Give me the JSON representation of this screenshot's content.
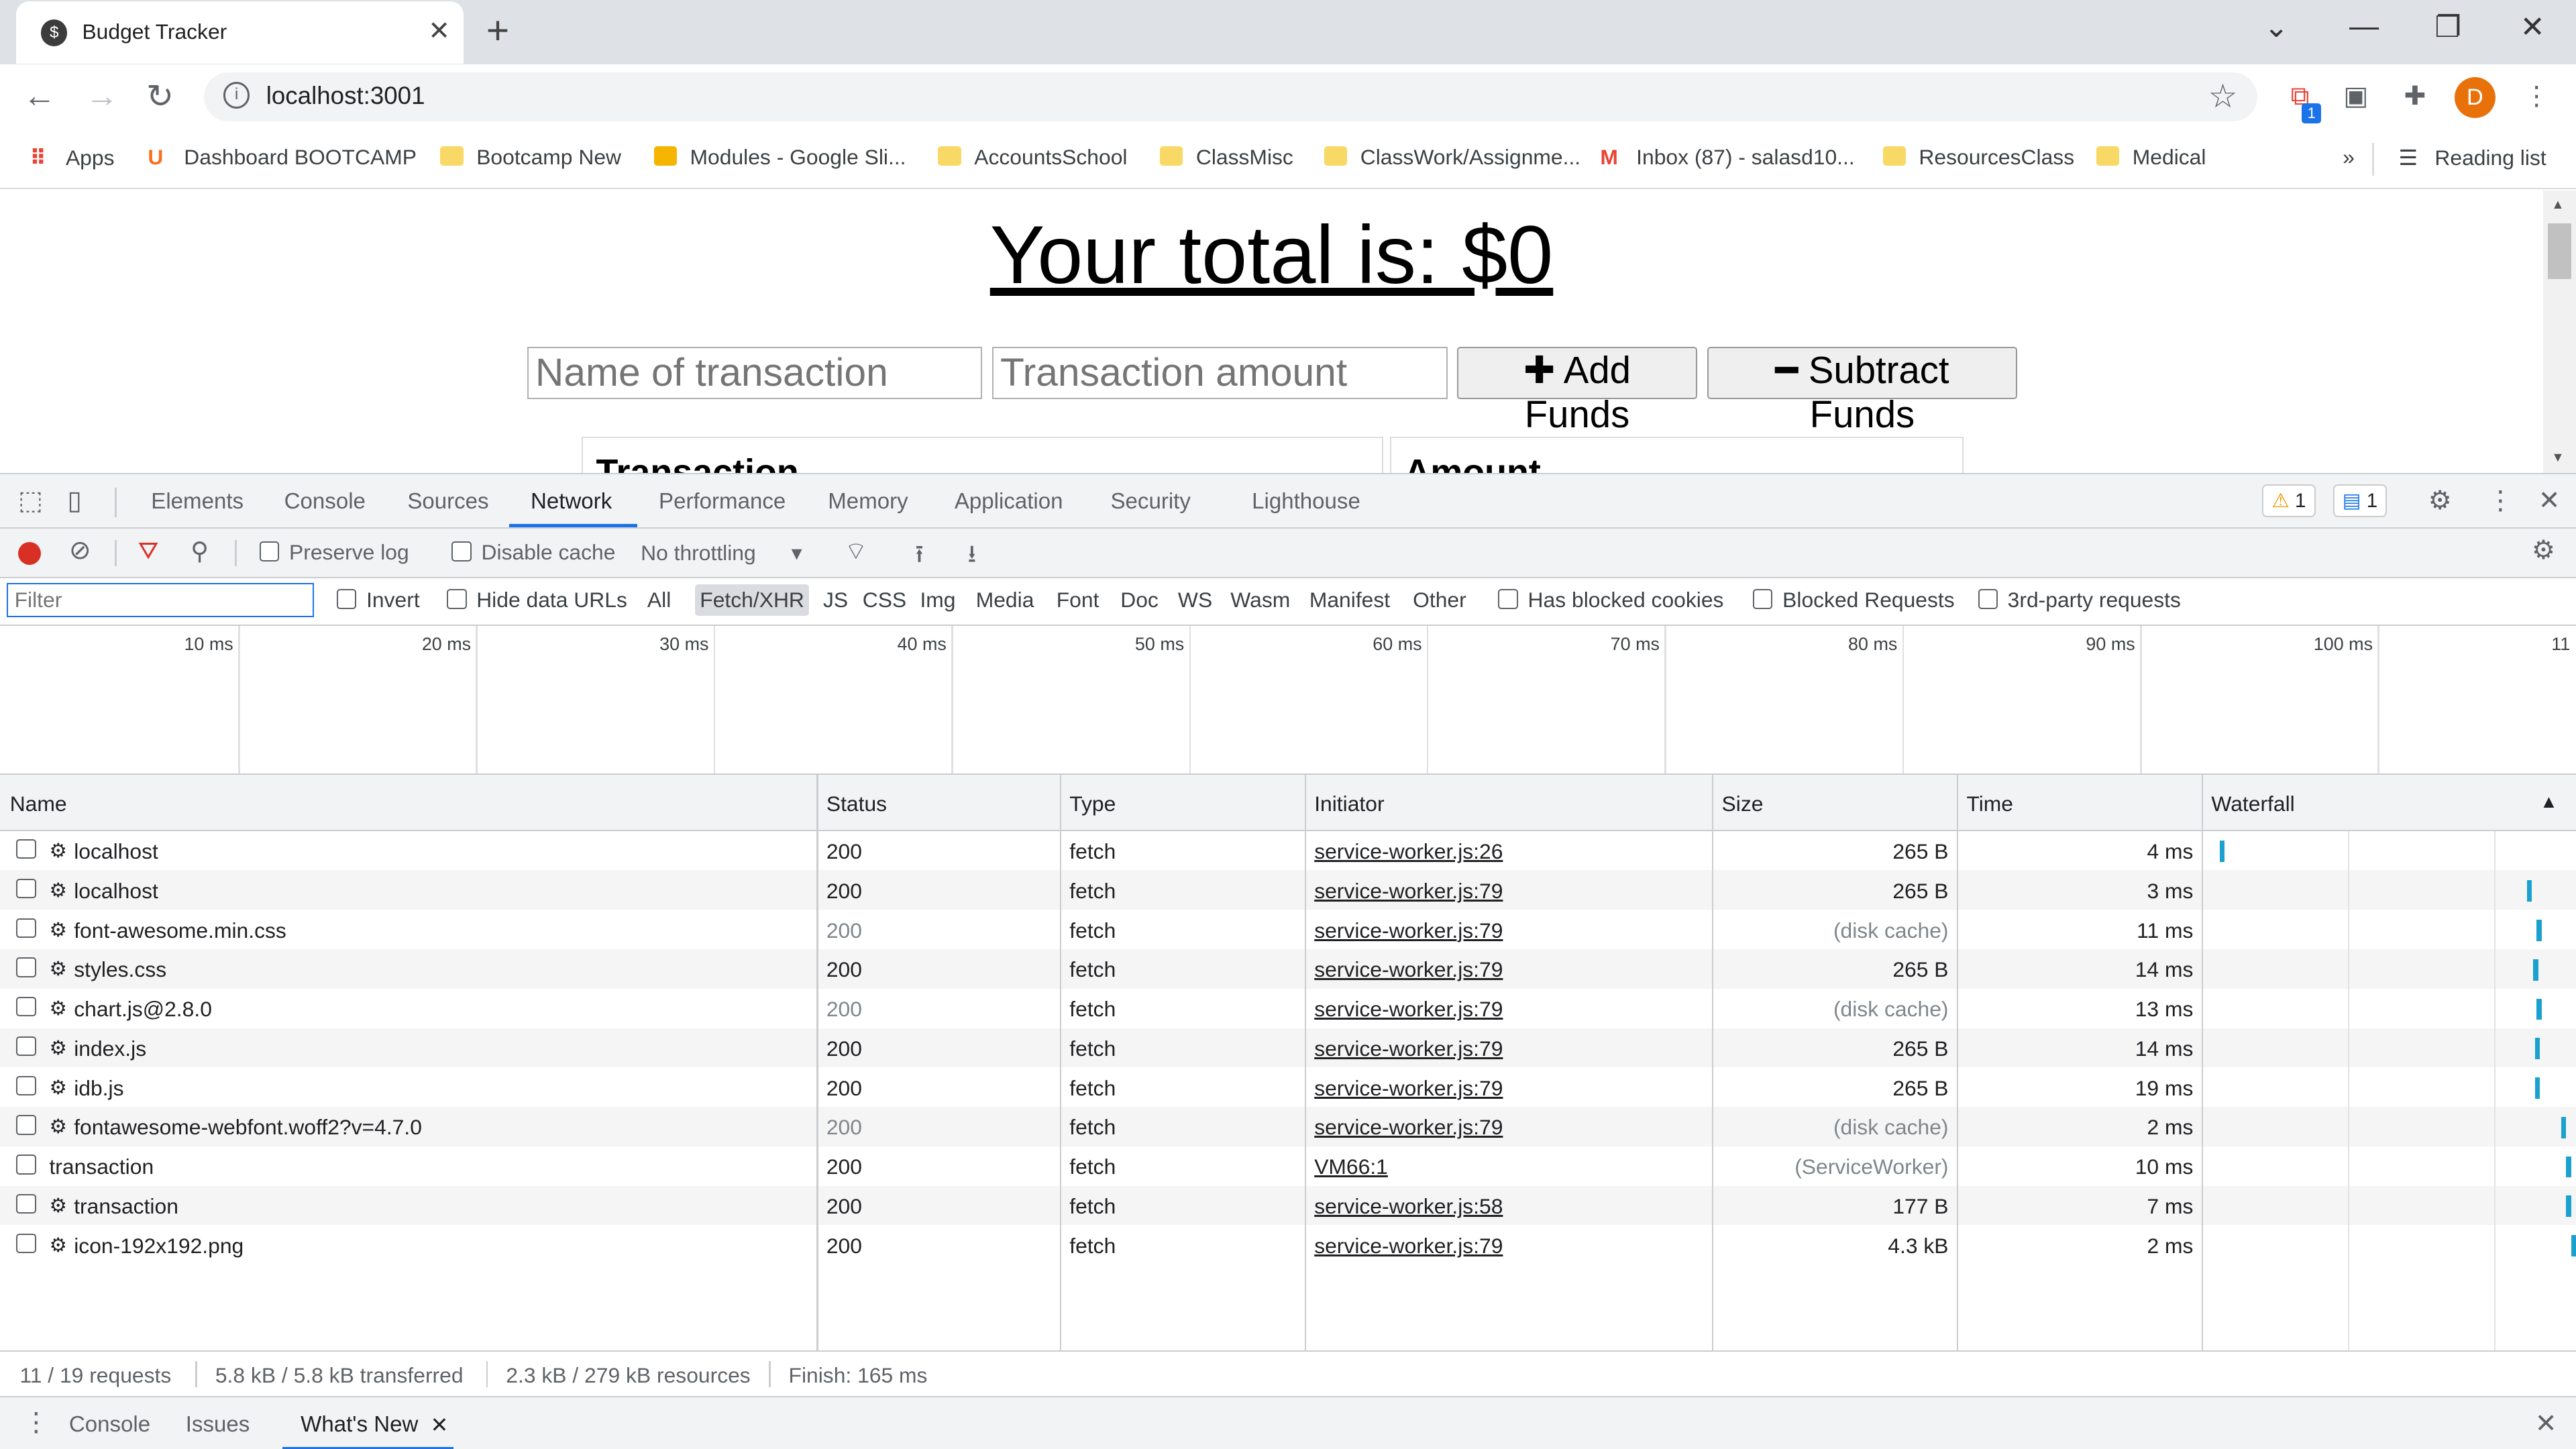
{
  "browser": {
    "tab_title": "Budget Tracker",
    "url": "localhost:3001",
    "avatar_letter": "D",
    "ext_badge": "1",
    "bookmarks": [
      {
        "label": "Apps",
        "icon": "apps-grid-icon"
      },
      {
        "label": "Dashboard BOOTCAMP",
        "icon": "university-logo-icon"
      },
      {
        "label": "Bootcamp New",
        "icon": "folder-icon"
      },
      {
        "label": "Modules - Google Sli...",
        "icon": "google-slides-icon"
      },
      {
        "label": "AccountsSchool",
        "icon": "folder-icon"
      },
      {
        "label": "ClassMisc",
        "icon": "folder-icon"
      },
      {
        "label": "ClassWork/Assignme...",
        "icon": "folder-icon"
      },
      {
        "label": "Inbox (87) - salasd10...",
        "icon": "gmail-icon"
      },
      {
        "label": "ResourcesClass",
        "icon": "folder-icon"
      },
      {
        "label": "Medical",
        "icon": "folder-icon"
      }
    ],
    "overflow": "»",
    "reading_list": "Reading list"
  },
  "page": {
    "total_text": "Your total is: $0",
    "name_placeholder": "Name of transaction",
    "amount_placeholder": "Transaction amount",
    "add_label": "Add Funds",
    "subtract_label": "Subtract Funds",
    "table_headers": [
      "Transaction",
      "Amount"
    ]
  },
  "devtools": {
    "tabs": [
      "Elements",
      "Console",
      "Sources",
      "Network",
      "Performance",
      "Memory",
      "Application",
      "Security",
      "Lighthouse"
    ],
    "active_tab": "Network",
    "warnings_count": "1",
    "messages_count": "1",
    "network_toolbar": {
      "preserve_log": "Preserve log",
      "disable_cache": "Disable cache",
      "throttling": "No throttling"
    },
    "filter": {
      "placeholder": "Filter",
      "invert": "Invert",
      "hide_data_urls": "Hide data URLs",
      "types": [
        "All",
        "Fetch/XHR",
        "JS",
        "CSS",
        "Img",
        "Media",
        "Font",
        "Doc",
        "WS",
        "Wasm",
        "Manifest",
        "Other"
      ],
      "selected_type": "Fetch/XHR",
      "blocked_cookies": "Has blocked cookies",
      "blocked_requests": "Blocked Requests",
      "third_party": "3rd-party requests"
    },
    "timeline_ticks": [
      "10 ms",
      "20 ms",
      "30 ms",
      "40 ms",
      "50 ms",
      "60 ms",
      "70 ms",
      "80 ms",
      "90 ms",
      "100 ms",
      "11"
    ],
    "columns": [
      "Name",
      "Status",
      "Type",
      "Initiator",
      "Size",
      "Time",
      "Waterfall"
    ],
    "rows": [
      {
        "gear": true,
        "name": "localhost",
        "status": "200",
        "type": "fetch",
        "initiator": "service-worker.js:26",
        "size": "265 B",
        "time": "4 ms"
      },
      {
        "gear": true,
        "name": "localhost",
        "status": "200",
        "type": "fetch",
        "initiator": "service-worker.js:79",
        "size": "265 B",
        "time": "3 ms"
      },
      {
        "gear": true,
        "name": "font-awesome.min.css",
        "status": "200",
        "type": "fetch",
        "initiator": "service-worker.js:79",
        "size": "(disk cache)",
        "time": "11 ms"
      },
      {
        "gear": true,
        "name": "styles.css",
        "status": "200",
        "type": "fetch",
        "initiator": "service-worker.js:79",
        "size": "265 B",
        "time": "14 ms"
      },
      {
        "gear": true,
        "name": "chart.js@2.8.0",
        "status": "200",
        "type": "fetch",
        "initiator": "service-worker.js:79",
        "size": "(disk cache)",
        "time": "13 ms"
      },
      {
        "gear": true,
        "name": "index.js",
        "status": "200",
        "type": "fetch",
        "initiator": "service-worker.js:79",
        "size": "265 B",
        "time": "14 ms"
      },
      {
        "gear": true,
        "name": "idb.js",
        "status": "200",
        "type": "fetch",
        "initiator": "service-worker.js:79",
        "size": "265 B",
        "time": "19 ms"
      },
      {
        "gear": true,
        "name": "fontawesome-webfont.woff2?v=4.7.0",
        "status": "200",
        "type": "fetch",
        "initiator": "service-worker.js:79",
        "size": "(disk cache)",
        "time": "2 ms"
      },
      {
        "gear": false,
        "name": "transaction",
        "status": "200",
        "type": "fetch",
        "initiator": "VM66:1",
        "size": "(ServiceWorker)",
        "time": "10 ms"
      },
      {
        "gear": true,
        "name": "transaction",
        "status": "200",
        "type": "fetch",
        "initiator": "service-worker.js:58",
        "size": "177 B",
        "time": "7 ms"
      },
      {
        "gear": true,
        "name": "icon-192x192.png",
        "status": "200",
        "type": "fetch",
        "initiator": "service-worker.js:79",
        "size": "4.3 kB",
        "time": "2 ms"
      }
    ],
    "status_bar": {
      "requests": "11 / 19 requests",
      "transferred": "5.8 kB / 5.8 kB transferred",
      "resources": "2.3 kB / 279 kB resources",
      "finish": "Finish: 165 ms"
    },
    "drawer_tabs": [
      "Console",
      "Issues",
      "What's New"
    ],
    "drawer_active": "What's New",
    "colors": {
      "accent": "#1a73e8",
      "record": "#d93025"
    }
  }
}
